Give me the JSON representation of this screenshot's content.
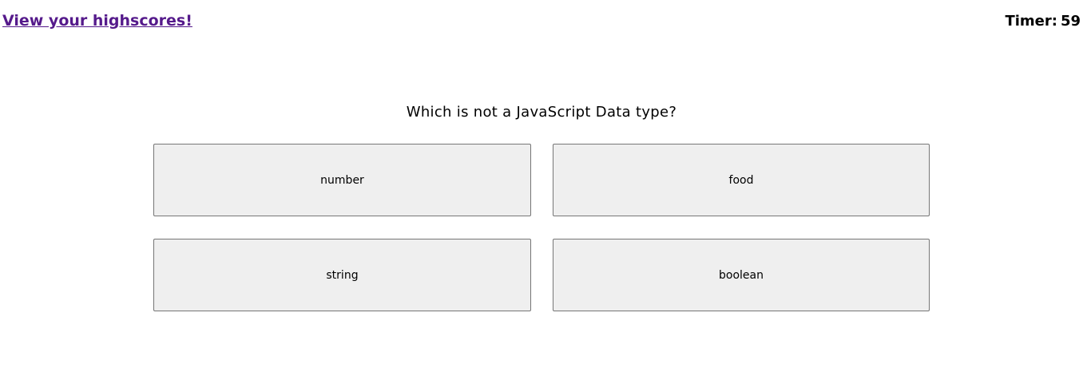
{
  "header": {
    "highscores_link": "View your highscores!",
    "timer_label": "Timer:",
    "timer_value": "59"
  },
  "quiz": {
    "question": "Which is not a JavaScript Data type?",
    "answers": [
      {
        "label": "number"
      },
      {
        "label": "food"
      },
      {
        "label": "string"
      },
      {
        "label": "boolean"
      }
    ]
  },
  "colors": {
    "link": "#551a8b",
    "button_bg": "#efefef",
    "button_border": "#767676"
  }
}
